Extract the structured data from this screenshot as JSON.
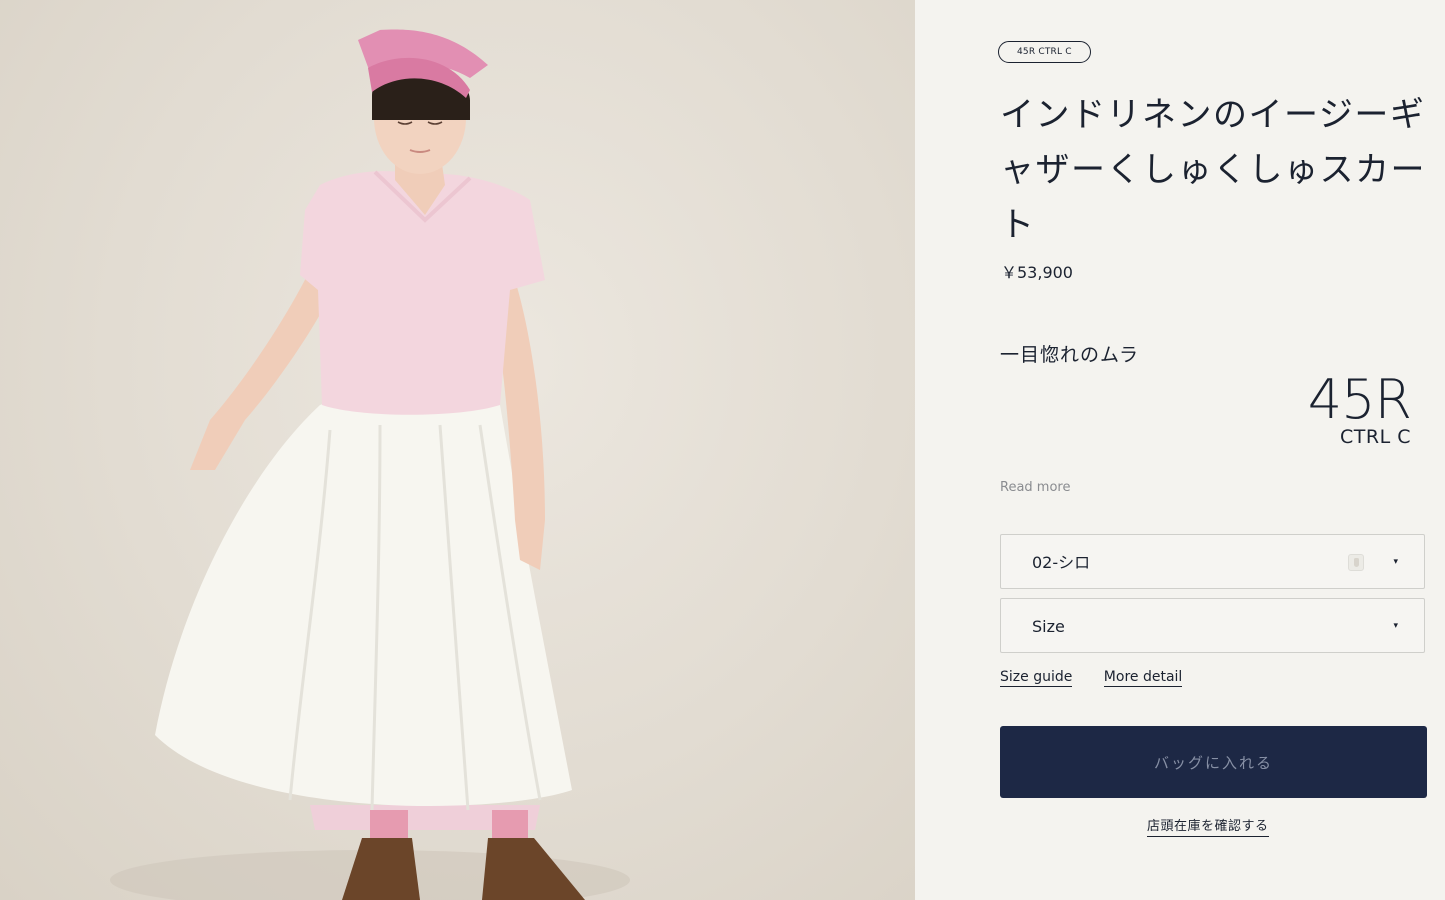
{
  "product": {
    "brand_pill": "45R CTRL C",
    "title": "インドリネンのイージーギャザーくしゅくしゅスカート",
    "price": "￥53,900",
    "tagline": "一目惚れのムラ",
    "brand_logo_big": "45R",
    "brand_logo_small": "CTRL C",
    "read_more": "Read more"
  },
  "options": {
    "color_selected": "02-シロ",
    "size_placeholder": "Size",
    "caret_glyph": "▾"
  },
  "links": {
    "size_guide": "Size guide",
    "more_detail": "More detail"
  },
  "actions": {
    "add_to_bag": "バッグに入れる",
    "check_store_stock": "店頭在庫を確認する"
  },
  "colors": {
    "button_bg": "#1d2845",
    "text_primary": "#1b2230",
    "panel_bg": "#f4f3ef"
  }
}
